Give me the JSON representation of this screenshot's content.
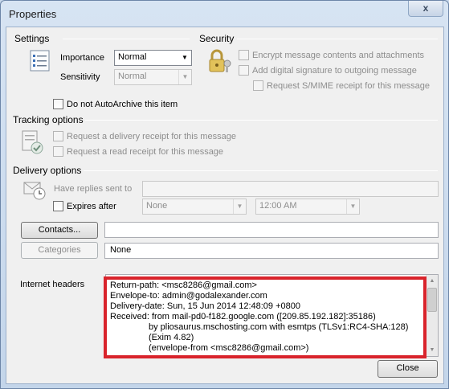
{
  "window": {
    "title": "Properties",
    "close_glyph": "x"
  },
  "settings": {
    "heading": "Settings",
    "importance_label": "Importance",
    "importance_value": "Normal",
    "sensitivity_label": "Sensitivity",
    "sensitivity_value": "Normal",
    "autoarchive_label": "Do not AutoArchive this item"
  },
  "security": {
    "heading": "Security",
    "encrypt_label": "Encrypt message contents and attachments",
    "signature_label": "Add digital signature to outgoing message",
    "smime_label": "Request S/MIME receipt for this message"
  },
  "tracking": {
    "heading": "Tracking options",
    "delivery_receipt_label": "Request a delivery receipt for this message",
    "read_receipt_label": "Request a read receipt for this message"
  },
  "delivery": {
    "heading": "Delivery options",
    "replies_label": "Have replies sent to",
    "expires_label": "Expires after",
    "expires_date": "None",
    "expires_time": "12:00 AM"
  },
  "contacts": {
    "button_label": "Contacts...",
    "value": ""
  },
  "categories": {
    "button_label": "Categories",
    "value": "None"
  },
  "internet_headers": {
    "label": "Internet headers",
    "lines": [
      "Return-path: <msc8286@gmail.com>",
      "Envelope-to: admin@godalexander.com",
      "Delivery-date: Sun, 15 Jun 2014 12:48:09 +0800",
      "Received: from mail-pd0-f182.google.com ([209.85.192.182]:35186)",
      "by pliosaurus.mschosting.com with esmtps (TLSv1:RC4-SHA:128)",
      "(Exim 4.82)",
      "(envelope-from <msc8286@gmail.com>)"
    ]
  },
  "footer": {
    "close_label": "Close"
  },
  "icons": [
    "settings-list-icon",
    "security-lock-icon",
    "tracking-icon",
    "delivery-icon",
    "close-icon"
  ],
  "colors": {
    "highlight": "#d9232b",
    "titlebar": "#c3d5ea",
    "dialog_bg": "#f0f0f0"
  }
}
